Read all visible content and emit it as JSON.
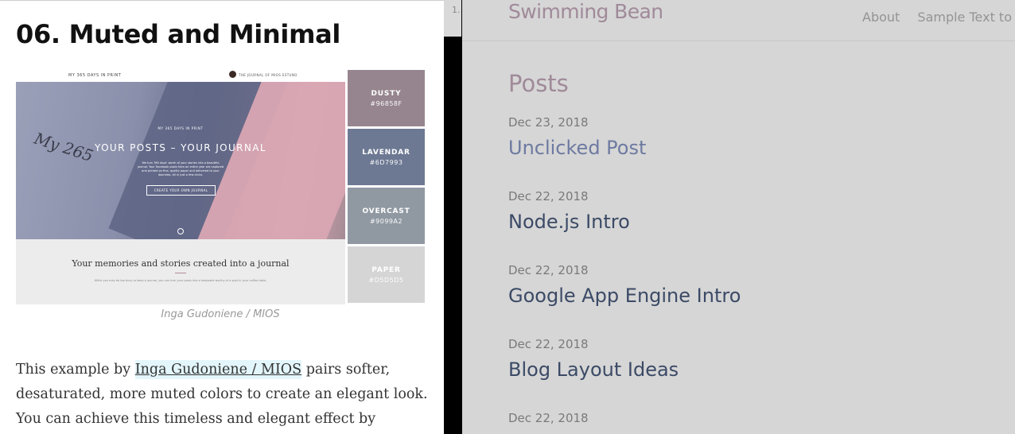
{
  "article": {
    "title": "06. Muted and Minimal",
    "mockup": {
      "brand": "MY 365 DAYS IN PRINT",
      "account": "THE JOURNAL OF MIOS ESTUNO",
      "script": "My 265",
      "kicker": "MY 365 DAYS IN PRINT",
      "headline": "YOUR POSTS  –  YOUR JOURNAL",
      "subcopy": "We turn 365 days' worth of your stories into a beautiful journal. Your Facebook posts from an entire year are captured and printed on fine, quality paper and delivered to your doorstep. All in just a few clicks.",
      "cta": "CREATE YOUR OWN JOURNAL",
      "tagline": "Your memories and stories created into a journal",
      "bottom_copy": "While you may be too busy to keep a journal, you can turn your posts into a keepsake worthy of a spot in your coffee table."
    },
    "swatches": [
      {
        "name": "DUSTY",
        "hex": "#96858F",
        "color": "#96858f"
      },
      {
        "name": "LAVENDAR",
        "hex": "#6D7993",
        "color": "#6d7993"
      },
      {
        "name": "OVERCAST",
        "hex": "#9099A2",
        "color": "#9099a2"
      },
      {
        "name": "PAPER",
        "hex": "#D5D5D5",
        "color": "#d5d5d5"
      }
    ],
    "caption": "Inga Gudoniene / MIOS",
    "body": {
      "before_link": "This example by ",
      "link": "Inga Gudoniene / MIOS",
      "after_link": " pairs softer, desaturated, more muted colors to create an elegant look. You can achieve this timeless and elegant effect by"
    }
  },
  "middle": {
    "tab_label": "1."
  },
  "blog": {
    "brand": "Swimming Bean",
    "nav": [
      "About",
      "Sample Text to P"
    ],
    "posts_heading": "Posts",
    "posts": [
      {
        "date": "Dec 23, 2018",
        "title": "Unclicked Post",
        "unclicked": true
      },
      {
        "date": "Dec 22, 2018",
        "title": "Node.js Intro",
        "unclicked": false
      },
      {
        "date": "Dec 22, 2018",
        "title": "Google App Engine Intro",
        "unclicked": false
      },
      {
        "date": "Dec 22, 2018",
        "title": "Blog Layout Ideas",
        "unclicked": false
      },
      {
        "date": "Dec 22, 2018",
        "title": "",
        "unclicked": false
      }
    ]
  }
}
